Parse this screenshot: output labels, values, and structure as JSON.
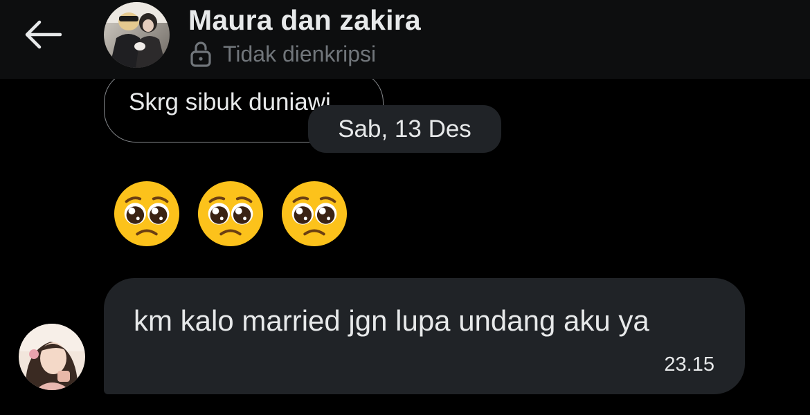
{
  "header": {
    "back_icon": "arrow-left-icon",
    "title": "Maura dan zakira",
    "encryption_icon": "unlocked-padlock-icon",
    "encryption_label": "Tidak dienkripsi"
  },
  "messages": {
    "outline_bubble_text": "Skrg sibuk duniawi",
    "date_separator": "Sab, 13 Des",
    "emoji_message": [
      "pleading-face-emoji",
      "pleading-face-emoji",
      "pleading-face-emoji"
    ],
    "incoming": {
      "text": "km kalo married jgn lupa undang aku ya",
      "time": "23.15"
    }
  },
  "colors": {
    "background": "#000000",
    "header_background": "#0d0e0f",
    "bubble_background": "#202327",
    "primary_text": "#e7e9ea",
    "secondary_text": "#71767b",
    "outline_border": "#8a8d91",
    "emoji_yellow": "#fcc21b"
  }
}
